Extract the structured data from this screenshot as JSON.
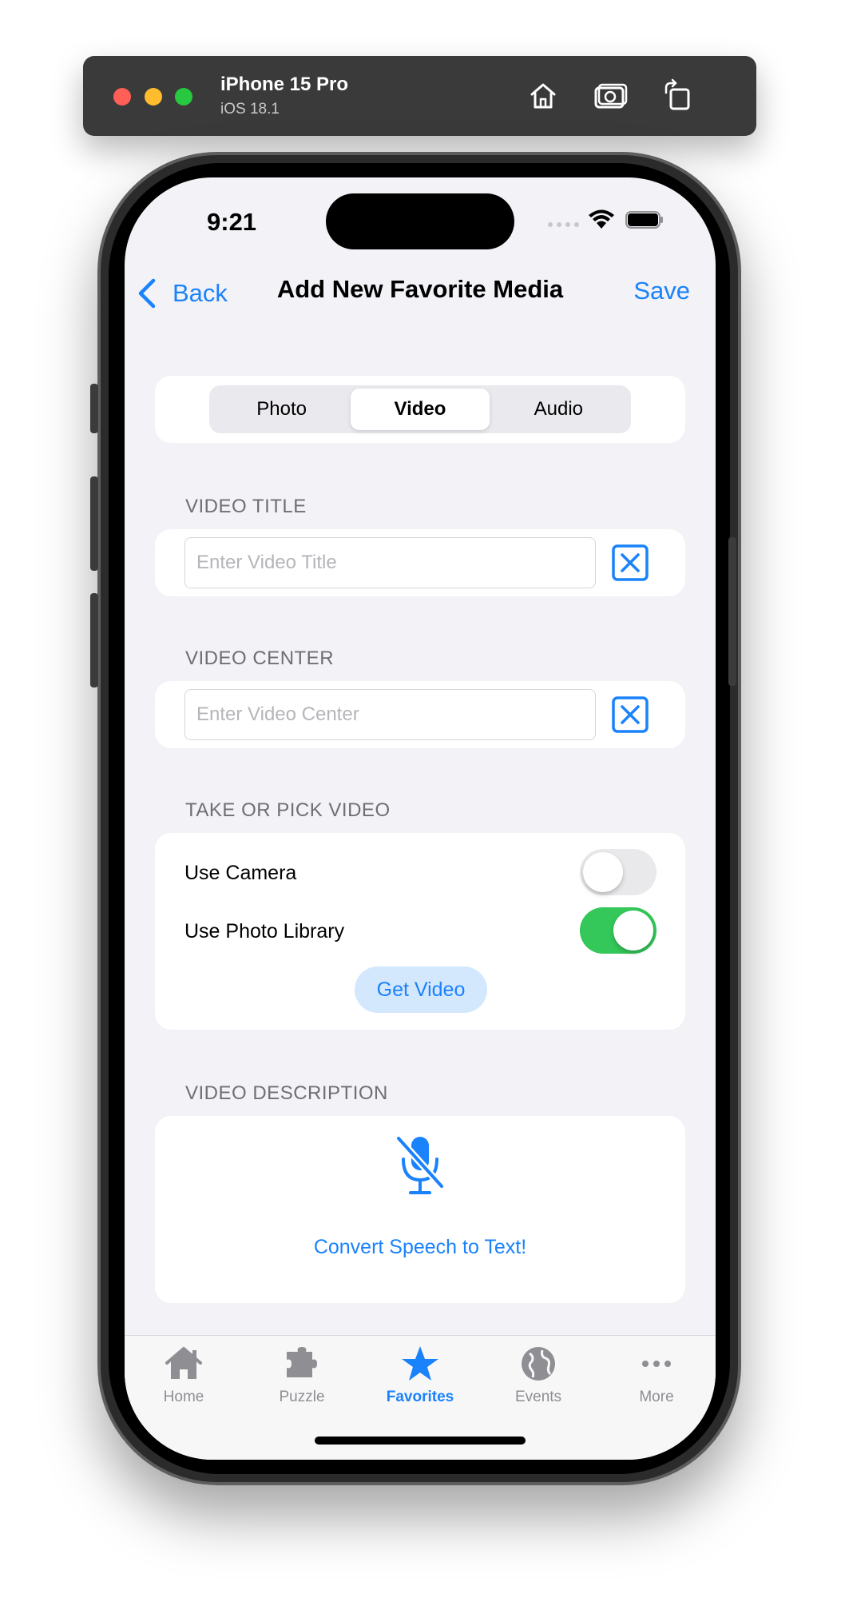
{
  "simulator": {
    "device": "iPhone 15 Pro",
    "os": "iOS 18.1",
    "buttons": [
      "home-icon",
      "screenshot-icon",
      "rotate-icon"
    ]
  },
  "status_bar": {
    "time": "9:21"
  },
  "nav": {
    "back_label": "Back",
    "title": "Add New Favorite Media",
    "save_label": "Save"
  },
  "segments": {
    "items": [
      "Photo",
      "Video",
      "Audio"
    ],
    "selected": "Video"
  },
  "video_title": {
    "label": "VIDEO TITLE",
    "placeholder": "Enter Video Title",
    "value": ""
  },
  "video_center": {
    "label": "VIDEO CENTER",
    "placeholder": "Enter Video Center",
    "value": ""
  },
  "take_pick": {
    "label": "TAKE OR PICK VIDEO",
    "use_camera": "Use Camera",
    "use_camera_on": false,
    "use_library": "Use Photo Library",
    "use_library_on": true,
    "get_video": "Get Video"
  },
  "description": {
    "label": "VIDEO DESCRIPTION",
    "mic_icon": "mic-slash-icon",
    "link": "Convert Speech to Text!"
  },
  "tabbar": {
    "items": [
      {
        "label": "Home",
        "icon": "house-icon"
      },
      {
        "label": "Puzzle",
        "icon": "puzzle-icon"
      },
      {
        "label": "Favorites",
        "icon": "star-icon"
      },
      {
        "label": "Events",
        "icon": "globe-icon"
      },
      {
        "label": "More",
        "icon": "ellipsis-icon"
      }
    ],
    "active": "Favorites"
  },
  "colors": {
    "accent": "#1a82fb",
    "toggle_on": "#34c759",
    "background": "#f2f2f7"
  }
}
